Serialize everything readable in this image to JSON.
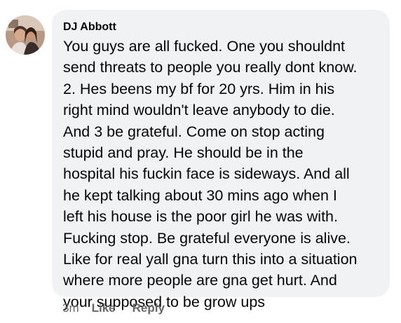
{
  "comment": {
    "author": "DJ Abbott",
    "avatar_icon": "profile-photo",
    "text_lines": [
      "You guys are all fucked. One you shouldnt",
      "send threats to people you really dont know.",
      "2. Hes beens my bf for 20 yrs. Him in his",
      "right mind wouldn't leave anybody to die.",
      "And 3 be grateful. Come on stop acting",
      "stupid and pray. He should be in the",
      "hospital his fuckin face is sideways. And all",
      "he kept talking about 30 mins ago when I",
      "left his house is the poor girl he was with.",
      "Fucking stop. Be grateful everyone is alive.",
      "Like for real yall gna turn this into a situation",
      "where more people are gna get hurt.  And",
      "your supposed to be grow ups"
    ],
    "timestamp": "3m",
    "actions": {
      "like_label": "Like",
      "reply_label": "Reply"
    }
  },
  "colors": {
    "bubble_bg": "#f0f2f5",
    "text": "#050505",
    "secondary_text": "#65676b"
  }
}
